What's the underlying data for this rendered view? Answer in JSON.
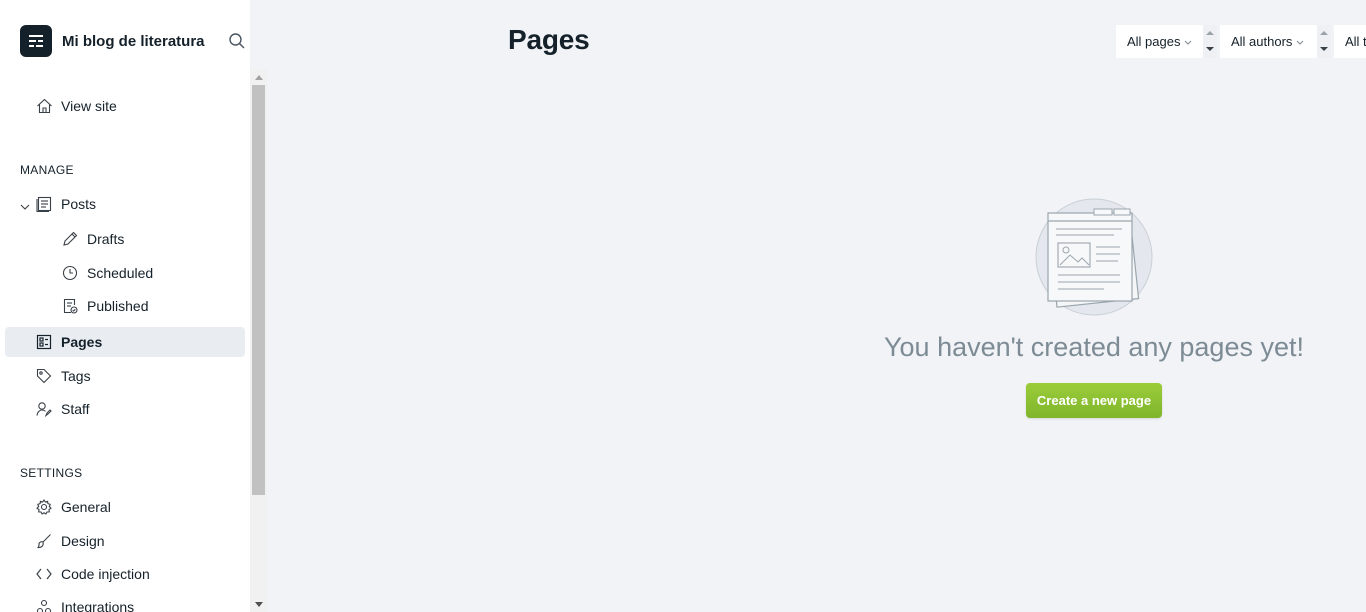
{
  "sidebar": {
    "blog_title": "Mi blog de literatura",
    "view_site": "View site",
    "manage_label": "MANAGE",
    "posts": "Posts",
    "drafts": "Drafts",
    "scheduled": "Scheduled",
    "published": "Published",
    "pages": "Pages",
    "tags": "Tags",
    "staff": "Staff",
    "settings_label": "SETTINGS",
    "general": "General",
    "design": "Design",
    "code_injection": "Code injection",
    "integrations": "Integrations"
  },
  "main": {
    "title": "Pages",
    "filters": {
      "type": "All pages",
      "authors": "All authors",
      "third": "All t"
    },
    "empty_message": "You haven't created any pages yet!",
    "create_button": "Create a new page"
  },
  "colors": {
    "accent_green": "#9bcd3a",
    "text_dark": "#15212a",
    "muted_text": "#7d8b95",
    "background": "#f1f3f7"
  }
}
